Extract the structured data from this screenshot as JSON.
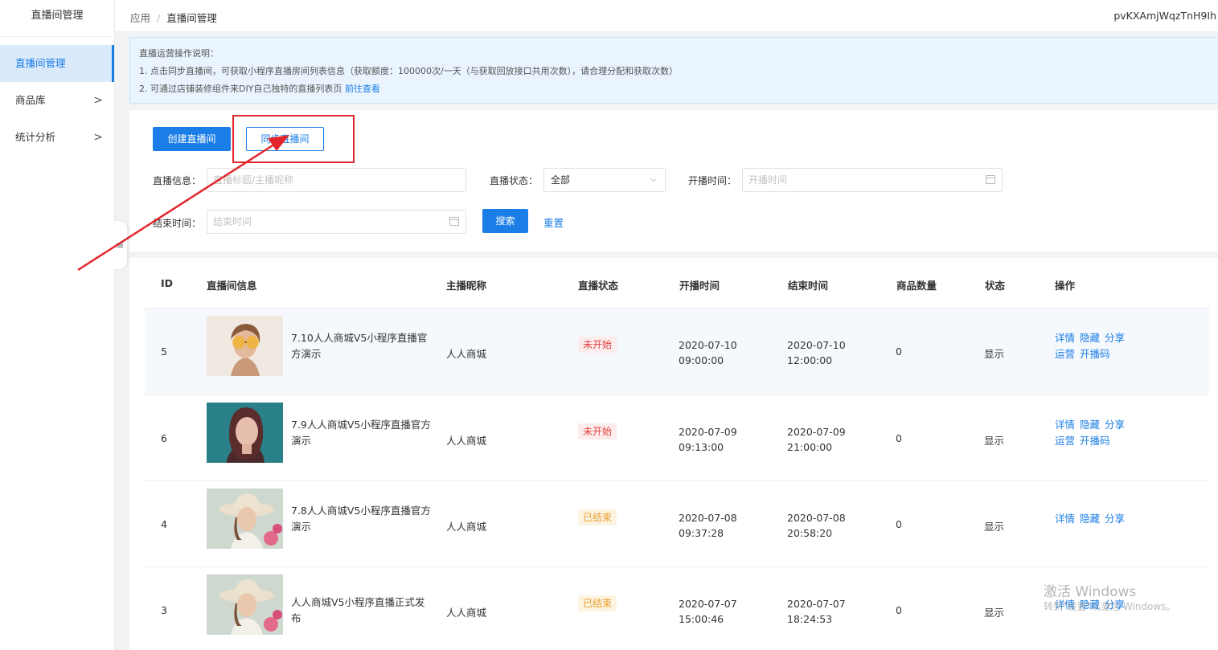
{
  "sidebar": {
    "title": "直播间管理",
    "items": [
      {
        "label": "直播间管理",
        "active": true
      },
      {
        "label": "商品库",
        "chevron": ">"
      },
      {
        "label": "统计分析",
        "chevron": ">"
      }
    ],
    "collapse_glyph": "≡"
  },
  "header": {
    "breadcrumb": [
      "应用",
      "直播间管理"
    ],
    "breadcrumb_sep": "/",
    "user_id": "pvKXAmjWqzTnH9Ih"
  },
  "notice": {
    "title": "直播运营操作说明：",
    "line1": "1. 点击同步直播间，可获取小程序直播房间列表信息（获取额度：100000次/一天（与获取回放接口共用次数），请合理分配和获取次数）",
    "line2": "2. 可通过店铺装修组件来DIY自己独特的直播列表页",
    "line2_link": "前往查看"
  },
  "toolbar": {
    "create_label": "创建直播间",
    "sync_label": "同步直播间"
  },
  "filters": {
    "info_label": "直播信息：",
    "info_placeholder": "直播标题/主播昵称",
    "status_label": "直播状态：",
    "status_value": "全部",
    "start_label": "开播时间：",
    "start_placeholder": "开播时间",
    "end_label": "结束时间：",
    "end_placeholder": "结束时间",
    "search_label": "搜索",
    "reset_label": "重置"
  },
  "table": {
    "columns": [
      "ID",
      "直播间信息",
      "主播昵称",
      "直播状态",
      "开播时间",
      "结束时间",
      "商品数量",
      "状态",
      "操作"
    ],
    "rows": [
      {
        "id": "5",
        "title": "7.10人人商城V5小程序直播官方演示",
        "anchor": "人人商城",
        "live_status": "未开始",
        "start_date": "2020-07-10",
        "start_time": "09:00:00",
        "end_date": "2020-07-10",
        "end_time": "12:00:00",
        "goods": "0",
        "state": "显示",
        "ops1": [
          "详情",
          "隐藏",
          "分享"
        ],
        "ops2": [
          "运营",
          "开播码"
        ]
      },
      {
        "id": "6",
        "title": "7.9人人商城V5小程序直播官方演示",
        "anchor": "人人商城",
        "live_status": "未开始",
        "start_date": "2020-07-09",
        "start_time": "09:13:00",
        "end_date": "2020-07-09",
        "end_time": "21:00:00",
        "goods": "0",
        "state": "显示",
        "ops1": [
          "详情",
          "隐藏",
          "分享"
        ],
        "ops2": [
          "运营",
          "开播码"
        ]
      },
      {
        "id": "4",
        "title": "7.8人人商城V5小程序直播官方演示",
        "anchor": "人人商城",
        "live_status": "已结束",
        "start_date": "2020-07-08",
        "start_time": "09:37:28",
        "end_date": "2020-07-08",
        "end_time": "20:58:20",
        "goods": "0",
        "state": "显示",
        "ops1": [
          "详情",
          "隐藏",
          "分享"
        ],
        "ops2": []
      },
      {
        "id": "3",
        "title": "人人商城V5小程序直播正式发布",
        "anchor": "人人商城",
        "live_status": "已结束",
        "start_date": "2020-07-07",
        "start_time": "15:00:46",
        "end_date": "2020-07-07",
        "end_time": "18:24:53",
        "goods": "0",
        "state": "显示",
        "ops1": [
          "详情",
          "隐藏",
          "分享"
        ],
        "ops2": []
      }
    ]
  },
  "watermark": {
    "line1": "激活 Windows",
    "line2": "转到\"设置\"以激活 Windows。"
  },
  "colors": {
    "accent": "#1b7ee6",
    "status_not_started": "#e04040",
    "status_ended": "#e89f2b",
    "annotation": "#e3262b"
  }
}
